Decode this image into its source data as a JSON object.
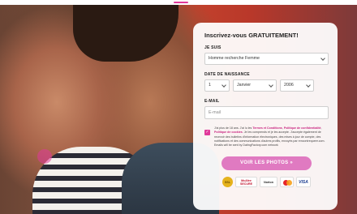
{
  "form": {
    "title": "Inscrivez-vous GRATUITEMENT!",
    "seeking_label": "JE SUIS",
    "seeking_value": "Homme recherche Femme",
    "dob_label": "DATE DE NAISSANCE",
    "dob_day": "1",
    "dob_month": "Janvier",
    "dob_year": "2006",
    "email_label": "E-MAIL",
    "email_placeholder": "E-mail",
    "consent_checked": true,
    "consent_part1": "J'ai plus de 18 ans. J'ai lu les ",
    "consent_link1": "Termes et Conditions",
    "consent_part2": ", ",
    "consent_link2": "Politique de confidentialité",
    "consent_part3": ", ",
    "consent_link3": "Politique de cookies",
    "consent_part4": ". Je les comprends et je les accepte. J'accepte également de recevoir des bulletins d'information électroniques, des mises à jour de compte, des notifications et des communications d'autres profils, envoyés par rencontrequeer.com. Emails will be sent by DatingFactory.com network",
    "cta_label": "VOIR LES PHOTOS »"
  },
  "badges": [
    {
      "name": "ssl-badge",
      "label": "SSL"
    },
    {
      "name": "mcafee-badge",
      "label": "McAfee SECURE"
    },
    {
      "name": "norton-badge",
      "label": "Norton"
    },
    {
      "name": "mastercard-badge",
      "label": ""
    },
    {
      "name": "visa-badge",
      "label": "VISA"
    }
  ],
  "colors": {
    "accent": "#e0399a",
    "cta": "#e07ac1",
    "link": "#c8237f"
  }
}
